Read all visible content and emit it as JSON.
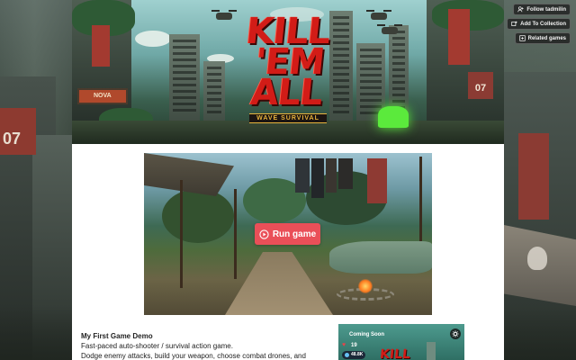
{
  "actions": {
    "follow_label": "Follow tadmilin",
    "collection_label": "Add To Collection",
    "related_label": "Related games"
  },
  "banner": {
    "logo_title_line1": "KILL",
    "logo_title_line2": "'EM ALL",
    "logo_subtitle": "WAVE SURVIVAL",
    "sign_number": "07",
    "sign_brand": "NOVA"
  },
  "game": {
    "run_label": "Run game"
  },
  "description": {
    "title": "My First Game Demo",
    "line1": "Fast-paced auto-shooter / survival action game.",
    "line2": "Dodge enemy attacks, build your weapon, choose combat drones, and"
  },
  "side_card": {
    "heading": "Coming Soon",
    "heart_count": "19",
    "steam_count": "48.8K",
    "mini_logo": "KILL"
  },
  "background": {
    "left_sign_number": "07"
  },
  "colors": {
    "run_button": "#ea4f58",
    "logo_red": "#d21c17",
    "panel_bg": "#ffffff"
  }
}
